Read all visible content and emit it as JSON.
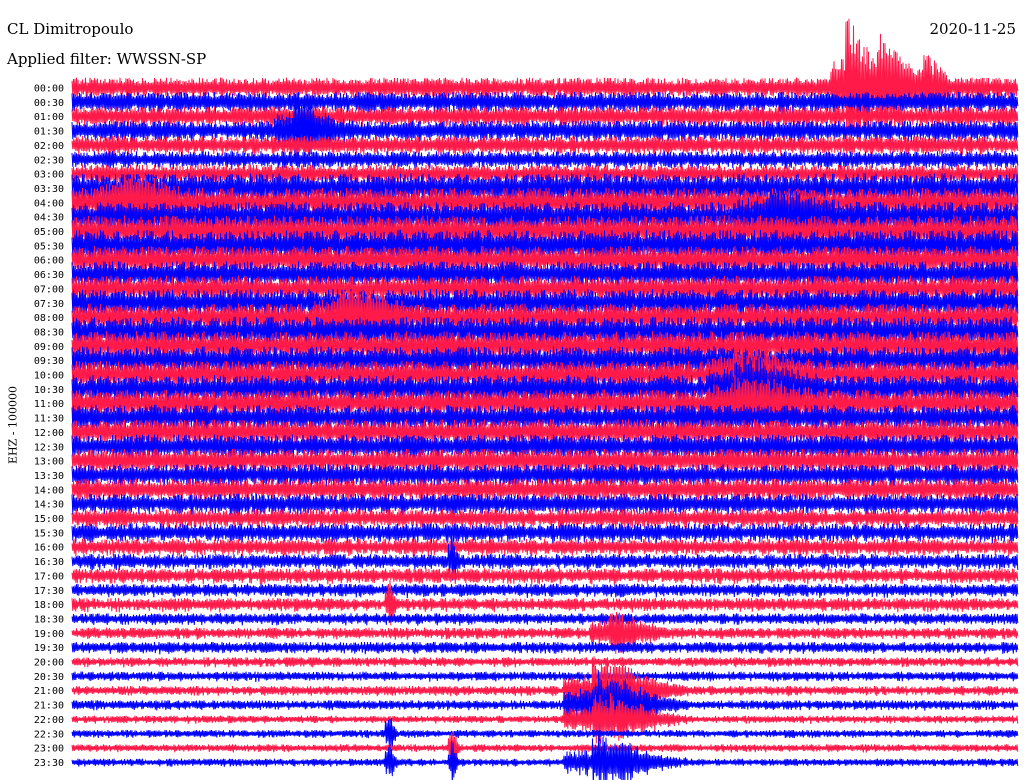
{
  "header": {
    "station": "CL Dimitropoulo",
    "filter": "Applied filter: WWSSN-SP",
    "date": "2020-11-25"
  },
  "axis": {
    "ylabel": "EHZ - 100000"
  },
  "chart_data": {
    "type": "helicorder",
    "title": "CL Dimitropoulo",
    "subtitle": "Applied filter: WWSSN-SP",
    "date": "2020-11-25",
    "ylabel": "EHZ - 100000",
    "row_interval_minutes": 30,
    "row_labels": [
      "00:00",
      "00:30",
      "01:00",
      "01:30",
      "02:00",
      "02:30",
      "03:00",
      "03:30",
      "04:00",
      "04:30",
      "05:00",
      "05:30",
      "06:00",
      "06:30",
      "07:00",
      "07:30",
      "08:00",
      "08:30",
      "09:00",
      "09:30",
      "10:00",
      "10:30",
      "11:00",
      "11:30",
      "12:00",
      "12:30",
      "13:00",
      "13:30",
      "14:00",
      "14:30",
      "15:00",
      "15:30",
      "16:00",
      "16:30",
      "17:00",
      "17:30",
      "18:00",
      "18:30",
      "19:00",
      "19:30",
      "20:00",
      "20:30",
      "21:00",
      "21:30",
      "22:00",
      "22:30",
      "23:00",
      "23:30"
    ],
    "trace_colors": [
      "#ff1a4a",
      "#0000ff"
    ],
    "amplitude_level": [
      0.55,
      0.55,
      0.55,
      0.55,
      0.5,
      0.45,
      0.5,
      0.8,
      0.8,
      0.8,
      0.85,
      0.85,
      0.75,
      0.7,
      0.7,
      0.75,
      0.75,
      0.8,
      0.8,
      0.75,
      0.75,
      0.75,
      0.75,
      0.7,
      0.7,
      0.65,
      0.65,
      0.6,
      0.6,
      0.55,
      0.5,
      0.5,
      0.45,
      0.4,
      0.4,
      0.35,
      0.35,
      0.3,
      0.3,
      0.3,
      0.25,
      0.25,
      0.25,
      0.25,
      0.2,
      0.2,
      0.2,
      0.2
    ],
    "events": [
      {
        "row": 0,
        "minute": 24.5,
        "peak": 5.0,
        "duration_min": 1.5
      },
      {
        "row": 0,
        "minute": 25.5,
        "peak": 4.0,
        "duration_min": 1.2
      },
      {
        "row": 0,
        "minute": 27.0,
        "peak": 2.2,
        "duration_min": 1.0
      },
      {
        "row": 0,
        "minute": 26.0,
        "peak": 2.5,
        "duration_min": 1.2
      },
      {
        "row": 3,
        "minute": 7.0,
        "peak": 1.8,
        "duration_min": 2.0
      },
      {
        "row": 8,
        "minute": 1.5,
        "peak": 1.6,
        "duration_min": 2.5
      },
      {
        "row": 9,
        "minute": 22.0,
        "peak": 1.5,
        "duration_min": 3.0
      },
      {
        "row": 16,
        "minute": 8.5,
        "peak": 1.5,
        "duration_min": 3.0
      },
      {
        "row": 20,
        "minute": 21.0,
        "peak": 1.8,
        "duration_min": 3.0
      },
      {
        "row": 21,
        "minute": 21.0,
        "peak": 1.8,
        "duration_min": 3.0
      },
      {
        "row": 22,
        "minute": 21.0,
        "peak": 1.5,
        "duration_min": 3.0
      },
      {
        "row": 33,
        "minute": 12.0,
        "peak": 2.2,
        "duration_min": 0.3
      },
      {
        "row": 36,
        "minute": 10.0,
        "peak": 3.0,
        "duration_min": 0.3
      },
      {
        "row": 38,
        "minute": 17.0,
        "peak": 1.5,
        "duration_min": 2.0
      },
      {
        "row": 42,
        "minute": 16.5,
        "peak": 2.5,
        "duration_min": 3.0
      },
      {
        "row": 43,
        "minute": 16.5,
        "peak": 2.5,
        "duration_min": 3.0
      },
      {
        "row": 44,
        "minute": 16.5,
        "peak": 2.0,
        "duration_min": 3.0
      },
      {
        "row": 45,
        "minute": 10.0,
        "peak": 2.0,
        "duration_min": 0.3
      },
      {
        "row": 46,
        "minute": 12.0,
        "peak": 2.0,
        "duration_min": 0.3
      },
      {
        "row": 47,
        "minute": 10.0,
        "peak": 2.0,
        "duration_min": 0.3
      },
      {
        "row": 47,
        "minute": 12.0,
        "peak": 2.0,
        "duration_min": 0.3
      },
      {
        "row": 47,
        "minute": 16.5,
        "peak": 2.0,
        "duration_min": 3.0
      }
    ]
  }
}
